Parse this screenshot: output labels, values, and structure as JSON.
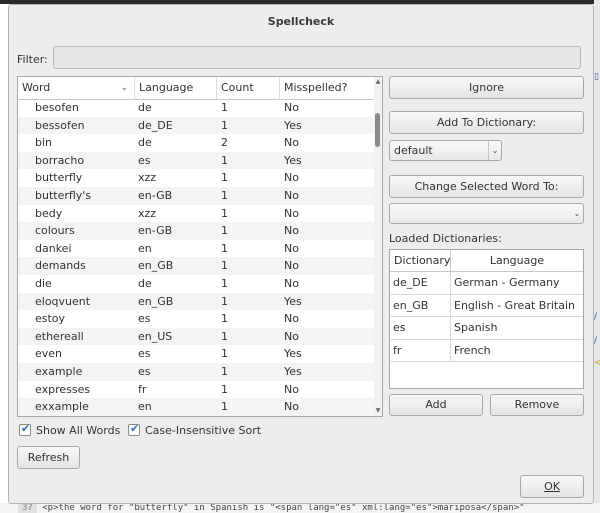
{
  "dialog": {
    "title": "Spellcheck",
    "filter_label": "Filter:",
    "filter_value": ""
  },
  "table": {
    "headers": [
      "Word",
      "Language",
      "Count",
      "Misspelled?"
    ],
    "rows": [
      [
        "besofen",
        "de",
        "1",
        "No"
      ],
      [
        "bessofen",
        "de_DE",
        "1",
        "Yes"
      ],
      [
        "bin",
        "de",
        "2",
        "No"
      ],
      [
        "borracho",
        "es",
        "1",
        "Yes"
      ],
      [
        "butterfly",
        "xzz",
        "1",
        "No"
      ],
      [
        "butterfly's",
        "en-GB",
        "1",
        "No"
      ],
      [
        "bedy",
        "xzz",
        "1",
        "No"
      ],
      [
        "colours",
        "en-GB",
        "1",
        "No"
      ],
      [
        "dankei",
        "en",
        "1",
        "No"
      ],
      [
        "demands",
        "en_GB",
        "1",
        "No"
      ],
      [
        "die",
        "de",
        "1",
        "No"
      ],
      [
        "eloqvuent",
        "en_GB",
        "1",
        "Yes"
      ],
      [
        "estoy",
        "es",
        "1",
        "No"
      ],
      [
        "ethereall",
        "en_US",
        "1",
        "No"
      ],
      [
        "even",
        "es",
        "1",
        "Yes"
      ],
      [
        "example",
        "es",
        "1",
        "Yes"
      ],
      [
        "expresses",
        "fr",
        "1",
        "No"
      ],
      [
        "exxample",
        "en",
        "1",
        "No"
      ]
    ]
  },
  "actions": {
    "ignore": "Ignore",
    "add_to_dictionary": "Add To Dictionary:",
    "dictionary_select": "default",
    "change_word": "Change Selected Word To:",
    "change_word_value": "",
    "loaded_label": "Loaded Dictionaries:",
    "add": "Add",
    "remove": "Remove"
  },
  "dictionaries": {
    "headers": [
      "Dictionary",
      "Language"
    ],
    "rows": [
      [
        "de_DE",
        "German - Germany"
      ],
      [
        "en_GB",
        "English - Great Britain"
      ],
      [
        "es",
        "Spanish"
      ],
      [
        "fr",
        "French"
      ]
    ]
  },
  "options": {
    "show_all_words": "Show All Words",
    "case_insensitive": "Case-Insensitive Sort",
    "show_all_checked": true,
    "case_insensitive_checked": true
  },
  "footer": {
    "refresh": "Refresh",
    "ok": "OK"
  },
  "background": {
    "line_number": "37",
    "code_text": "<p>the word for \"butterfly\" in Spanish is \"<span lang=\"es\" xml:lang=\"es\">mariposa</span>\""
  }
}
